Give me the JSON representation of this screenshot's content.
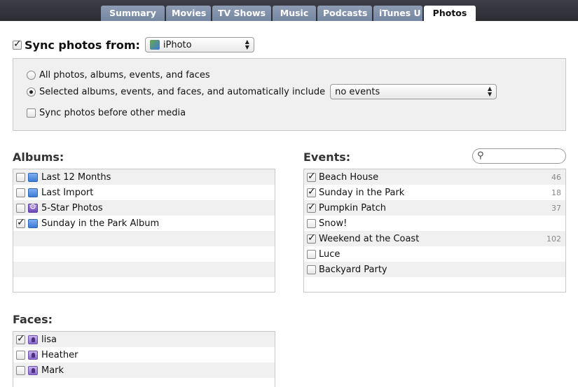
{
  "tabs": [
    "Summary",
    "Movies",
    "TV Shows",
    "Music",
    "Podcasts",
    "iTunes U",
    "Photos"
  ],
  "active_tab": "Photos",
  "sync": {
    "label": "Sync photos from:",
    "checked": true,
    "source": "iPhoto"
  },
  "options": {
    "all_label": "All photos, albums, events, and faces",
    "selected_label": "Selected albums, events, and faces, and automatically include",
    "include_value": "no events",
    "before_media_label": "Sync photos before other media"
  },
  "albums": {
    "heading": "Albums:",
    "items": [
      {
        "label": "Last 12 Months",
        "checked": false,
        "icon": "album-icon"
      },
      {
        "label": "Last Import",
        "checked": false,
        "icon": "album-icon"
      },
      {
        "label": "5-Star Photos",
        "checked": false,
        "icon": "smart-album-icon"
      },
      {
        "label": "Sunday in the Park Album",
        "checked": true,
        "icon": "album-icon"
      }
    ]
  },
  "events": {
    "heading": "Events:",
    "search_placeholder": "",
    "items": [
      {
        "label": "Beach House",
        "checked": true,
        "count": "46"
      },
      {
        "label": "Sunday in the Park",
        "checked": true,
        "count": "18"
      },
      {
        "label": "Pumpkin Patch",
        "checked": true,
        "count": "37"
      },
      {
        "label": "Snow!",
        "checked": false,
        "count": ""
      },
      {
        "label": "Weekend at the Coast",
        "checked": true,
        "count": "102"
      },
      {
        "label": "Luce",
        "checked": false,
        "count": ""
      },
      {
        "label": "Backyard Party",
        "checked": false,
        "count": ""
      }
    ]
  },
  "faces": {
    "heading": "Faces:",
    "items": [
      {
        "label": "lisa",
        "checked": true
      },
      {
        "label": "Heather",
        "checked": false
      },
      {
        "label": "Mark",
        "checked": false
      }
    ]
  }
}
